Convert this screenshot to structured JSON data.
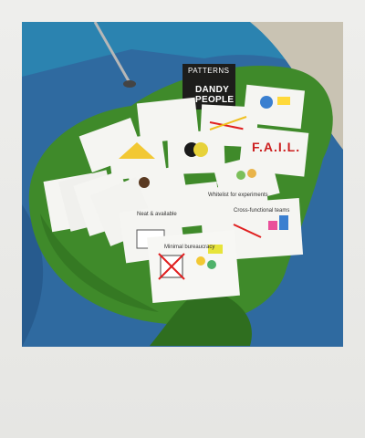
{
  "scene": {
    "description_colors": {
      "carpet_blue": "#2f6aa0",
      "table_green": "#3f8a2a",
      "card_white": "#f5f5f2",
      "brand_card": "#1d1d1b",
      "fail_red": "#cc1f1f"
    }
  },
  "cards": {
    "brand": {
      "title": "PATTERNS",
      "name_line1": "DANDY",
      "name_line2": "PEOPLE"
    },
    "fail": "F.A.I.L.",
    "minimal": "Minimal bureaucracy",
    "cross": "Cross-functional teams",
    "neat": "Neat & available",
    "experiments": "Whitelist for experiments"
  }
}
